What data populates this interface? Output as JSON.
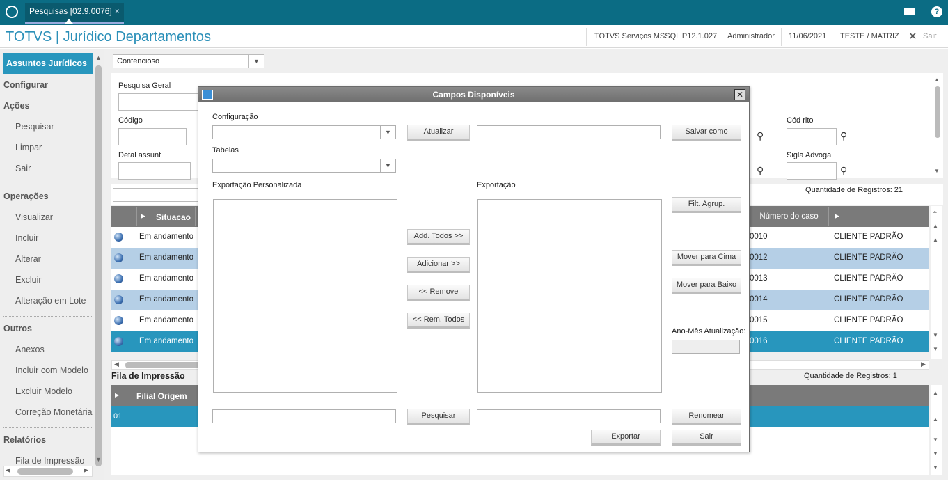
{
  "topbar": {
    "tab_label": "Pesquisas [02.9.0076]",
    "tab_close": "×"
  },
  "header": {
    "app_title": "TOTVS | Jurídico Departamentos",
    "environment": "TOTVS Serviços MSSQL P12.1.027",
    "user": "Administrador",
    "date": "11/06/2021",
    "company": "TESTE / MATRIZ",
    "exit_label": "Sair"
  },
  "sidebar": {
    "active": "Assuntos Jurídicos",
    "configurar": "Configurar",
    "acoes": "Ações",
    "acoes_items": [
      "Pesquisar",
      "Limpar",
      "Sair"
    ],
    "operacoes": "Operações",
    "operacoes_items": [
      "Visualizar",
      "Incluir",
      "Alterar",
      "Excluir",
      "Alteração em Lote"
    ],
    "outros": "Outros",
    "outros_items": [
      "Anexos",
      "Incluir com Modelo",
      "Excluir Modelo",
      "Correção Monetária"
    ],
    "relatorios": "Relatórios",
    "relatorios_items": [
      "Fila de Impressão"
    ]
  },
  "main": {
    "combo_value": "Contencioso",
    "filters": {
      "pesquisa_geral": "Pesquisa Geral",
      "codigo": "Código",
      "detal_assunt": "Detal assunt",
      "cod_rito": "Cód rito",
      "sigla_advoga": "Sigla Advoga"
    },
    "grid": {
      "count_label": "Quantidade de Registros: 21",
      "col_situacao": "Situacao",
      "col_numero": "Número do caso",
      "rows": [
        {
          "situacao": "Em andamento",
          "numero": "0010",
          "cliente": "CLIENTE PADRÃO"
        },
        {
          "situacao": "Em andamento",
          "numero": "0012",
          "cliente": "CLIENTE PADRÃO"
        },
        {
          "situacao": "Em andamento",
          "numero": "0013",
          "cliente": "CLIENTE PADRÃO"
        },
        {
          "situacao": "Em andamento",
          "numero": "0014",
          "cliente": "CLIENTE PADRÃO"
        },
        {
          "situacao": "Em andamento",
          "numero": "0015",
          "cliente": "CLIENTE PADRÃO"
        },
        {
          "situacao": "Em andamento",
          "numero": "0016",
          "cliente": "CLIENTE PADRÃO"
        }
      ]
    },
    "fila": {
      "title": "Fila de Impressão",
      "count_label": "Quantidade de Registros: 1",
      "col_filial": "Filial Origem",
      "row_value": "01"
    }
  },
  "dialog": {
    "title": "Campos Disponíveis",
    "configuracao_label": "Configuração",
    "tabelas_label": "Tabelas",
    "atualizar": "Atualizar",
    "salvar_como": "Salvar como",
    "exp_personalizada_label": "Exportação Personalizada",
    "exportacao_label": "Exportação",
    "filt_agrup": "Filt. Agrup.",
    "add_todos": "Add. Todos >>",
    "adicionar": "Adicionar >>",
    "remove": "<< Remove",
    "rem_todos": "<< Rem. Todos",
    "mover_cima": "Mover para Cima",
    "mover_baixo": "Mover para Baixo",
    "ano_mes_label": "Ano-Mês Atualização:",
    "pesquisar": "Pesquisar",
    "renomear": "Renomear",
    "exportar": "Exportar",
    "sair": "Sair"
  }
}
